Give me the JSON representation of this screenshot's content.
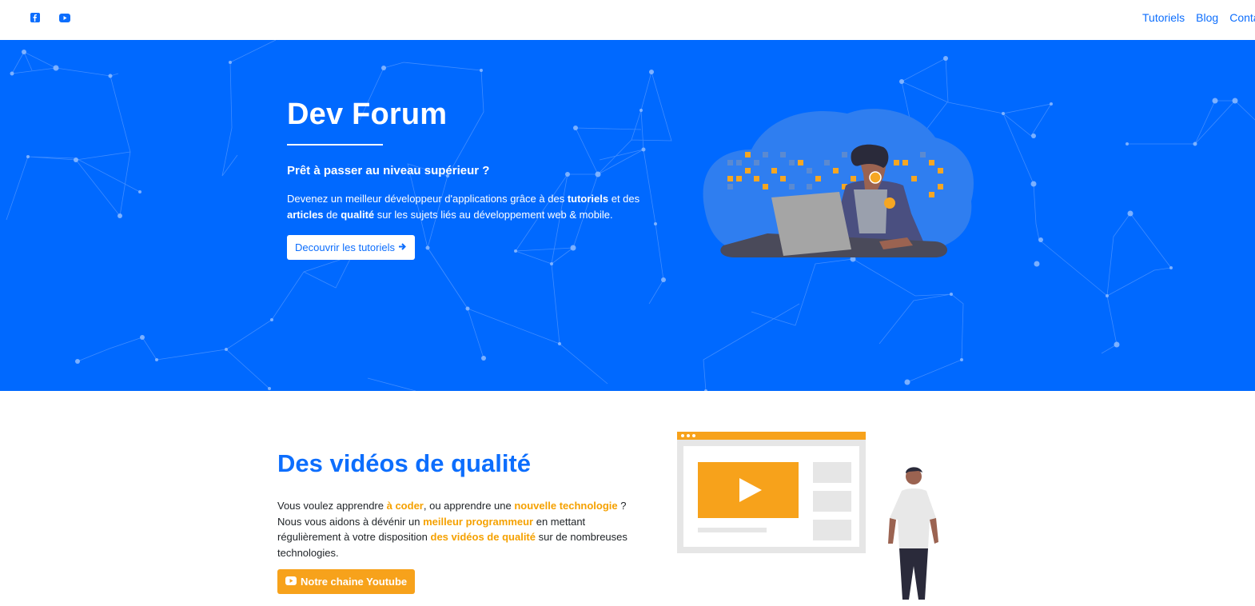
{
  "nav": {
    "links": [
      "Tutoriels",
      "Blog",
      "Contact"
    ],
    "icons": [
      "facebook-icon",
      "youtube-icon"
    ],
    "accent": "#0d6efd"
  },
  "hero": {
    "title": "Dev Forum",
    "subtitle": "Prêt à passer au niveau supérieur ?",
    "text_1": "Devenez un meilleur développeur d'applications grâce à des ",
    "bold_1": "tutoriels",
    "text_2": " et des ",
    "bold_2": "articles",
    "text_3": " de ",
    "bold_3": "qualité",
    "text_4": " sur les sujets liés au développement web & mobile.",
    "button": "Decouvrir les tutoriels",
    "background": "#0069ff"
  },
  "videos": {
    "title": "Des vidéos de qualité",
    "p1": "Vous voulez apprendre ",
    "h1": "à coder",
    "p2": ", ou apprendre une ",
    "h2": "nouvelle technologie",
    "p3": " ? Nous vous aidons à dévénir un ",
    "h3": "meilleur programmeur",
    "p4": " en mettant régulièrement à votre disposition ",
    "h4": "des vidéos de qualité",
    "p5": " sur de nombreuses technologies.",
    "button": "Notre chaine Youtube",
    "highlight_color": "#f5a100"
  }
}
